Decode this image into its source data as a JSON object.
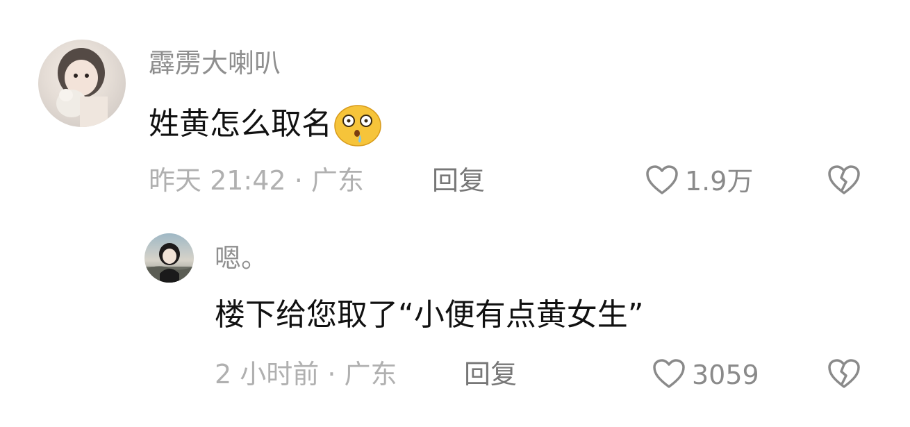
{
  "comments": [
    {
      "username": "霹雳大喇叭",
      "text": "姓黄怎么取名",
      "emoji": "shocked-drooling-emoji",
      "time": "昨天 21:42",
      "separator": "·",
      "location": "广东",
      "reply_label": "回复",
      "likes": "1.9万"
    },
    {
      "username": "嗯。",
      "text": "楼下给您取了“小便有点黄女生”",
      "time": "2 小时前",
      "separator": "·",
      "location": "广东",
      "reply_label": "回复",
      "likes": "3059"
    }
  ],
  "icons": {
    "like": "heart-outline-icon",
    "dislike": "broken-heart-icon"
  },
  "colors": {
    "username": "#8f8f8f",
    "text": "#111111",
    "meta": "#b0b0b0",
    "icon": "#8a8a8a"
  }
}
